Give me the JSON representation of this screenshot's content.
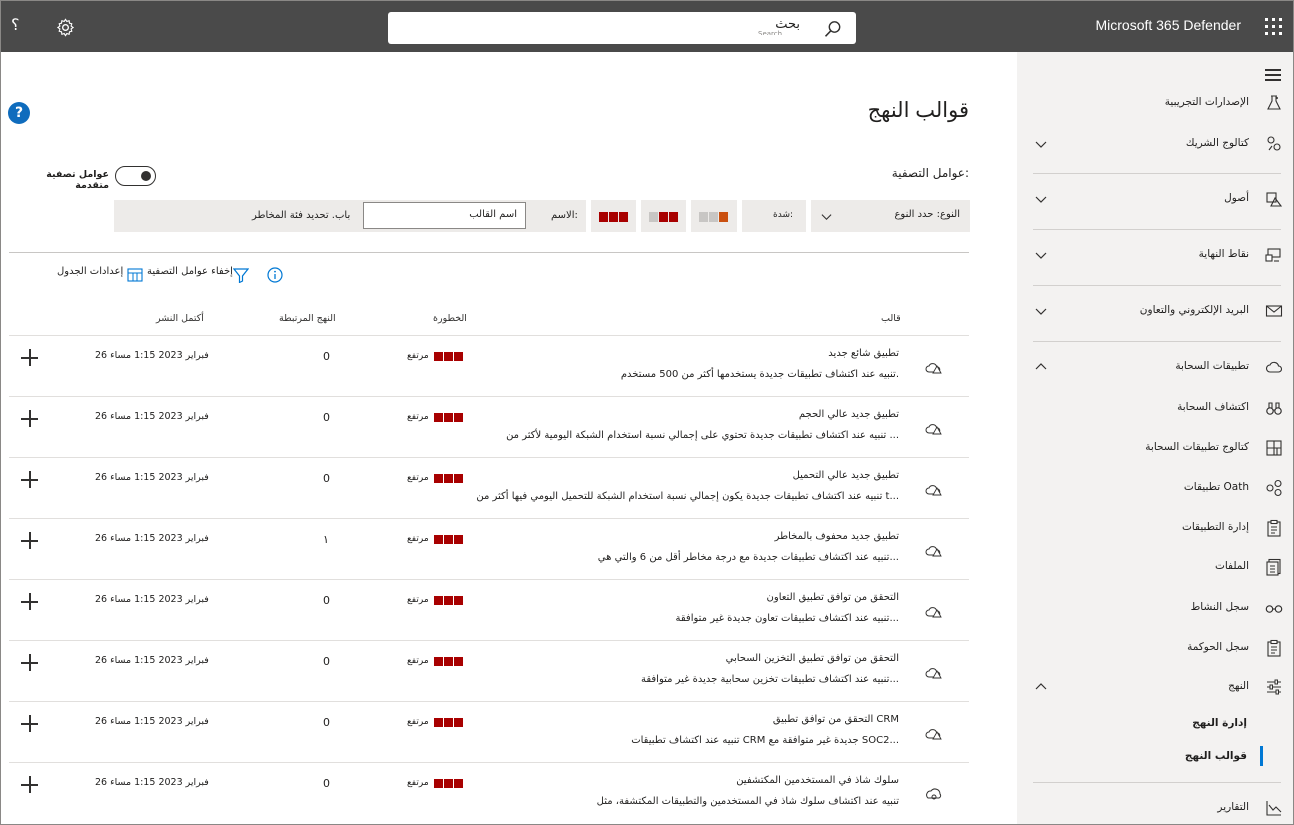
{
  "topbar": {
    "brand": "Microsoft 365 Defender",
    "search_label": "بحث",
    "search_ghost": "Search",
    "help_glyph": "؟"
  },
  "sidebar": {
    "items": [
      {
        "label": "الإصدارات التجريبية",
        "icon": "flask-icon",
        "chevron": ""
      },
      {
        "label": "كتالوج الشريك",
        "icon": "partner-icon",
        "chevron": "down"
      },
      {
        "label": "أصول",
        "icon": "assets-icon",
        "chevron": "down"
      },
      {
        "label": "نقاط النهاية",
        "icon": "endpoints-icon",
        "chevron": "down"
      },
      {
        "label": "البريد الإلكتروني والتعاون",
        "icon": "mail-icon",
        "chevron": "down"
      },
      {
        "label": "تطبيقات السحابة",
        "icon": "cloud-icon",
        "chevron": "up"
      },
      {
        "label": "اكتشاف السحابة",
        "icon": "binoculars-icon",
        "chevron": ""
      },
      {
        "label": "كتالوج تطبيقات السحابة",
        "icon": "grid-icon",
        "chevron": ""
      },
      {
        "label": "تطبيقات Oath",
        "icon": "oauth-icon",
        "chevron": ""
      },
      {
        "label": "إدارة التطبيقات",
        "icon": "clipboard-icon",
        "chevron": ""
      },
      {
        "label": "الملفات",
        "icon": "files-icon",
        "chevron": ""
      },
      {
        "label": "سجل النشاط",
        "icon": "glasses-icon",
        "chevron": ""
      },
      {
        "label": "سجل الحوكمة",
        "icon": "clipboard-icon",
        "chevron": ""
      },
      {
        "label": "النهج",
        "icon": "sliders-icon",
        "chevron": "up"
      },
      {
        "label": "إدارة النهج",
        "icon": "",
        "chevron": ""
      },
      {
        "label": "قوالب النهج",
        "icon": "",
        "chevron": ""
      },
      {
        "label": "التقارير",
        "icon": "chart-icon",
        "chevron": ""
      }
    ]
  },
  "main": {
    "title": "قوالب النهج",
    "help_glyph": "?",
    "filters_label": "عوامل التصفية:",
    "advanced_toggle_label": "عوامل تصفية متقدمة",
    "filterbar": {
      "type_label": "النوع: حدد النوع",
      "severity_label": "شدة:",
      "name_label": "الاسم:",
      "name_placeholder": "اسم القالب",
      "risk_label": "باب. تحديد فئة المخاطر"
    },
    "toolbar": {
      "hide_filters": "إخفاء عوامل التصفية",
      "table_settings": "إعدادات الجدول"
    },
    "columns": {
      "template": "قالب",
      "severity": "الخطورة",
      "linked": "النهج المرتبطة",
      "last_published": "أكتمل النشر"
    },
    "rows": [
      {
        "icon": "cloud-alert-icon",
        "title": "تطبيق شائع جديد",
        "desc": "تنبيه عند اكتشاف تطبيقات جديدة يستخدمها أكثر من 500 مستخدم.",
        "severity": "مرتفع",
        "linked": "0",
        "date": "26 فبراير 2023 1:15 مساء"
      },
      {
        "icon": "cloud-alert-icon",
        "title": "تطبيق جديد عالي الحجم",
        "desc": "تنبيه عند اكتشاف تطبيقات جديدة تحتوي على إجمالي نسبة استخدام الشبكة اليومية لأكثر من ...",
        "severity": "مرتفع",
        "linked": "0",
        "date": "26 فبراير 2023 1:15 مساء"
      },
      {
        "icon": "cloud-alert-icon",
        "title": "تطبيق جديد عالي التحميل",
        "desc": "تنبيه عند اكتشاف تطبيقات جديدة يكون إجمالي نسبة استخدام الشبكة للتحميل اليومي فيها أكثر من t...",
        "severity": "مرتفع",
        "linked": "0",
        "date": "26 فبراير 2023 1:15 مساء"
      },
      {
        "icon": "cloud-alert-icon",
        "title": "تطبيق جديد محفوف بالمخاطر",
        "desc": "تنبيه عند اكتشاف تطبيقات جديدة مع درجة مخاطر أقل من 6 والتي هي...",
        "severity": "مرتفع",
        "linked": "١",
        "date": "26 فبراير 2023 1:15 مساء"
      },
      {
        "icon": "cloud-alert-icon",
        "title": "التحقق من توافق تطبيق التعاون",
        "desc": "تنبيه عند اكتشاف تطبيقات تعاون جديدة غير متوافقة...",
        "severity": "مرتفع",
        "linked": "0",
        "date": "26 فبراير 2023 1:15 مساء"
      },
      {
        "icon": "cloud-alert-icon",
        "title": "التحقق من توافق تطبيق التخزين السحابي",
        "desc": "تنبيه عند اكتشاف تطبيقات تخزين سحابية جديدة غير متوافقة...",
        "severity": "مرتفع",
        "linked": "0",
        "date": "26 فبراير 2023 1:15 مساء"
      },
      {
        "icon": "cloud-alert-icon",
        "title": "التحقق من توافق تطبيق CRM",
        "desc": "تنبيه عند اكتشاف تطبيقات CRM جديدة غير متوافقة مع SOC2...",
        "severity": "مرتفع",
        "linked": "0",
        "date": "26 فبراير 2023 1:15 مساء"
      },
      {
        "icon": "anomaly-icon",
        "title": "سلوك شاذ في المستخدمين المكتشفين",
        "desc": "تنبيه عند اكتشاف سلوك شاذ في المستخدمين والتطبيقات المكتشفة، مثل",
        "severity": "مرتفع",
        "linked": "0",
        "date": "26 فبراير 2023 1:15 مساء"
      }
    ]
  },
  "colors": {
    "topbar": "#4a4a4a",
    "sidebar": "#f3f2f1",
    "severity_high": "#a80000",
    "severity_medium": "#ca5010",
    "accent": "#0078d4"
  }
}
